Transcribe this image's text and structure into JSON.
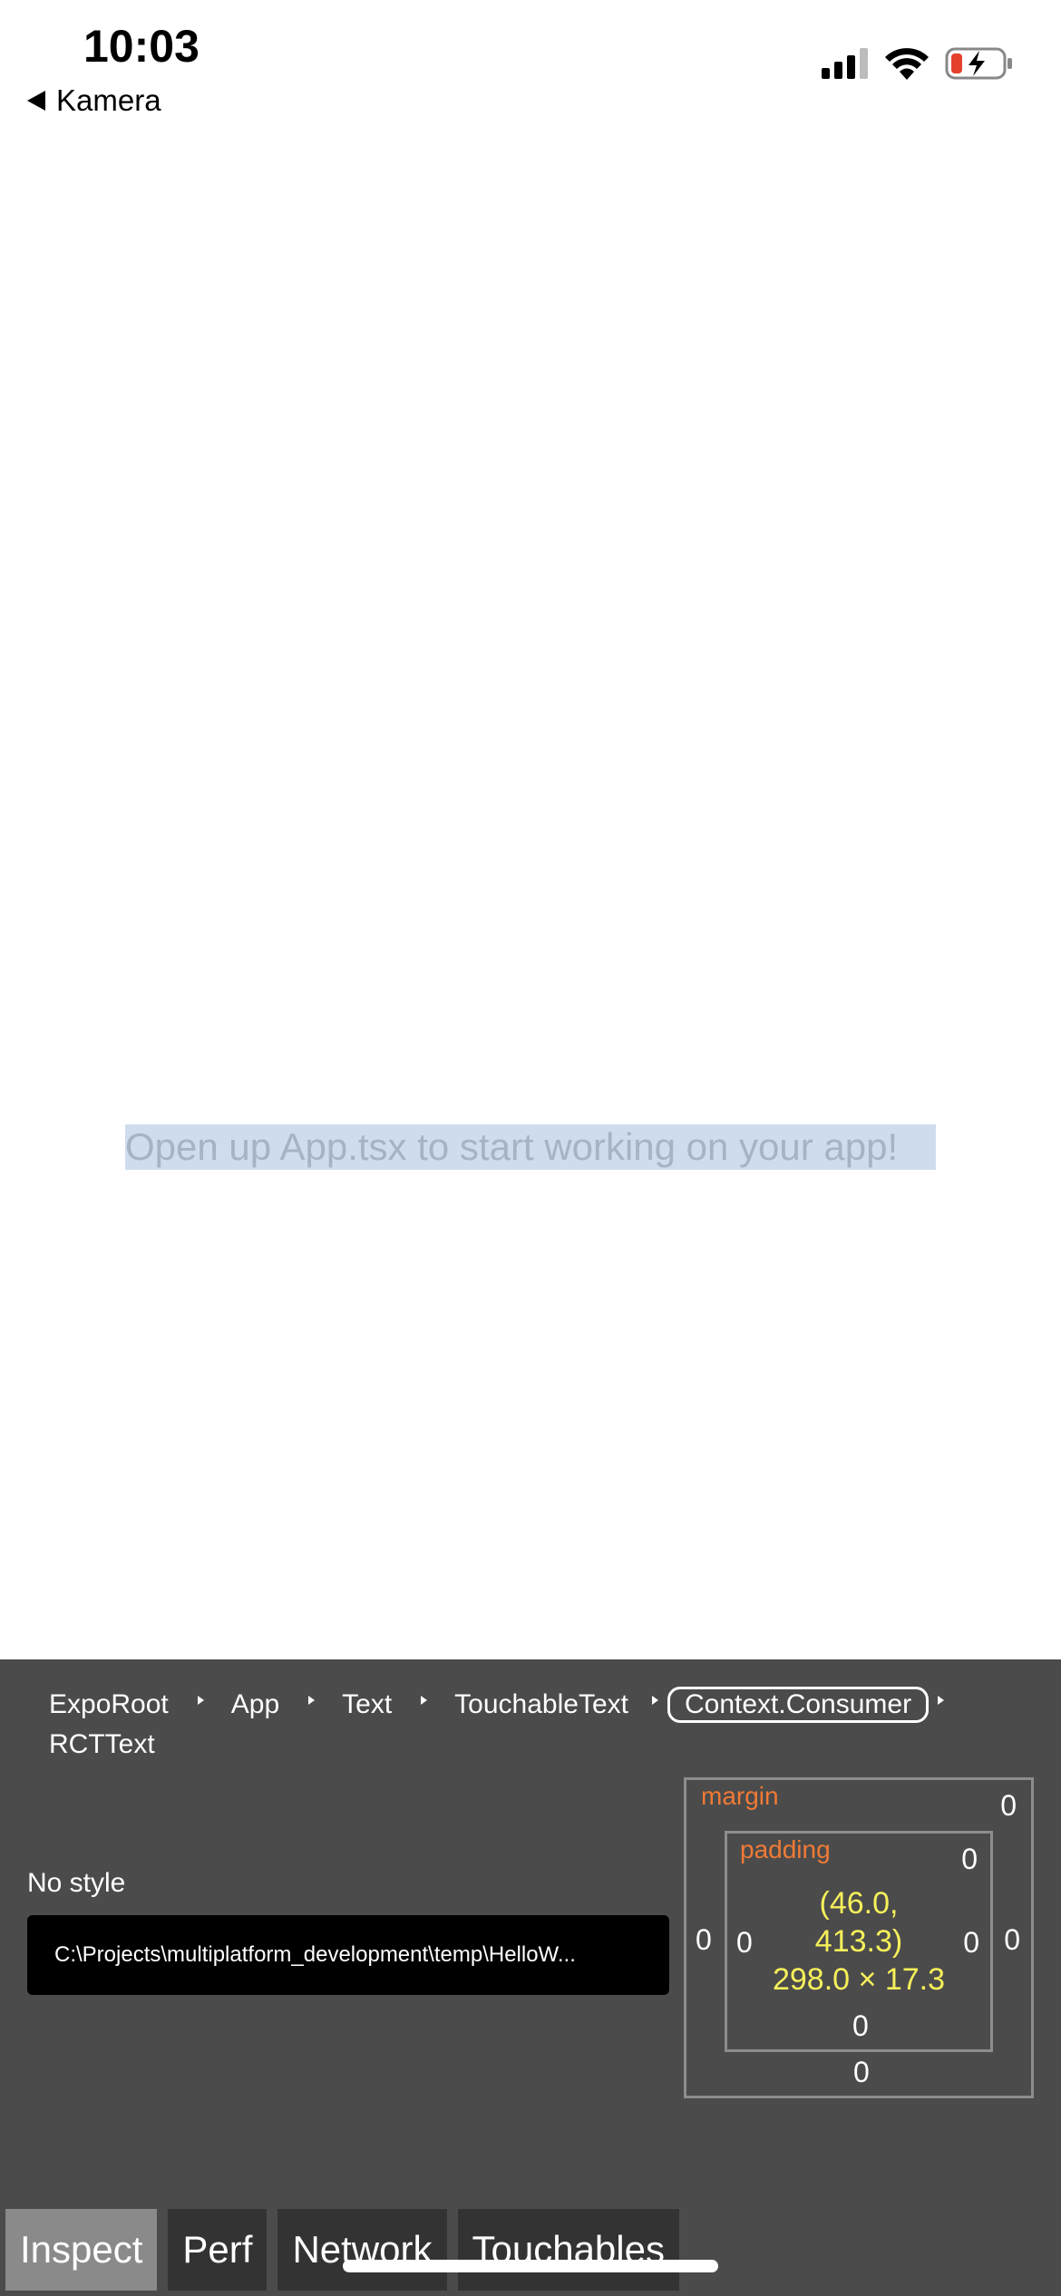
{
  "status_bar": {
    "time": "10:03",
    "back_label": "Kamera",
    "icons": [
      "cellular-signal-icon",
      "wifi-icon",
      "battery-charging-icon"
    ],
    "battery_color": "#e5402c"
  },
  "app": {
    "message": "Open up App.tsx to start working on your app!"
  },
  "inspector": {
    "hierarchy": [
      "ExpoRoot",
      "App",
      "Text",
      "TouchableText",
      "Context.Consumer",
      "RCTText"
    ],
    "selected": "Context.Consumer",
    "style_label": "No style",
    "file_path": "C:\\Projects\\multiplatform_development\\temp\\HelloW...",
    "box_model": {
      "margin_label": "margin",
      "padding_label": "padding",
      "margin": {
        "top": "0",
        "right": "0",
        "bottom": "0",
        "left": "0"
      },
      "padding": {
        "top": "0",
        "right": "0",
        "bottom": "0",
        "left": "0"
      },
      "position_line1": "(46.0,",
      "position_line2": "413.3)",
      "size": "298.0 × 17.3"
    },
    "tabs": [
      "Inspect",
      "Perf",
      "Network",
      "Touchables"
    ],
    "active_tab": "Inspect"
  }
}
